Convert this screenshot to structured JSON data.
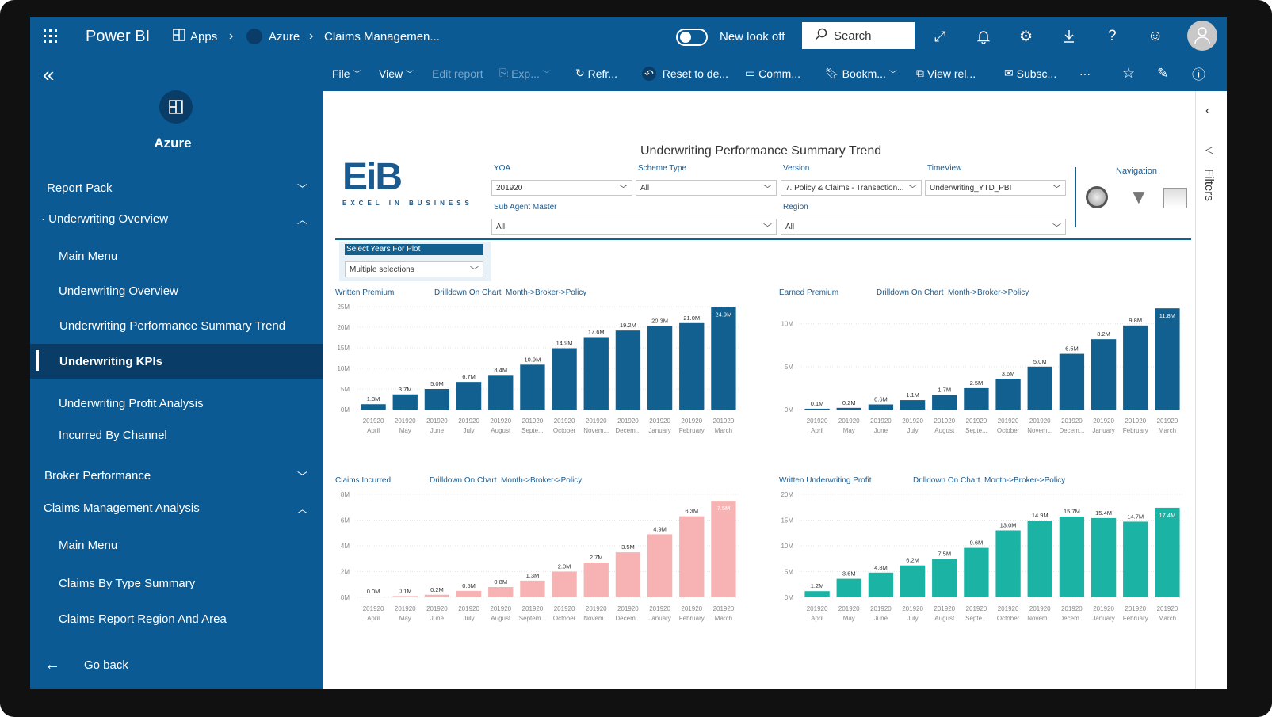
{
  "topbar": {
    "app_name": "Power BI",
    "breadcrumb": [
      {
        "label": "Apps"
      },
      {
        "label": "Azure"
      },
      {
        "label": "Claims Managemen..."
      }
    ],
    "new_look_label": "New look off",
    "search_placeholder": "Search"
  },
  "sidebar": {
    "workspace_name": "Azure",
    "items": [
      {
        "label": "Report Pack"
      },
      {
        "label": "Underwriting Overview"
      },
      {
        "label": "Main Menu"
      },
      {
        "label": "Underwriting Overview"
      },
      {
        "label": "Underwriting Performance Summary Trend"
      },
      {
        "label": "Underwriting KPIs"
      },
      {
        "label": "Underwriting Profit Analysis"
      },
      {
        "label": "Incurred By Channel"
      },
      {
        "label": "Broker Performance"
      },
      {
        "label": "Claims Management Analysis"
      },
      {
        "label": "Main Menu"
      },
      {
        "label": "Claims By Type Summary"
      },
      {
        "label": "Claims Report Region And Area"
      }
    ],
    "go_back": "Go back"
  },
  "actionbar": {
    "file": "File",
    "view": "View",
    "edit_report": "Edit report",
    "export": "Exp...",
    "refresh": "Refr...",
    "reset": "Reset to de...",
    "comments": "Comm...",
    "bookmarks": "Bookm...",
    "view_related": "View rel...",
    "subscribe": "Subsc...",
    "more": "···"
  },
  "rightpane": {
    "filters": "Filters"
  },
  "report": {
    "title": "Underwriting Performance Summary Trend",
    "logo_text": "EiB",
    "logo_sub": "EXCEL IN BUSINESS",
    "filters": {
      "yoa_label": "YOA",
      "yoa_value": "201920",
      "scheme_label": "Scheme Type",
      "scheme_value": "All",
      "version_label": "Version",
      "version_value": "7. Policy & Claims - Transaction...",
      "timeview_label": "TimeView",
      "timeview_value": "Underwriting_YTD_PBI",
      "subagent_label": "Sub Agent Master",
      "subagent_value": "All",
      "region_label": "Region",
      "region_value": "All",
      "navigation_label": "Navigation",
      "years_label": "Select Years For Plot",
      "years_value": "Multiple selections"
    },
    "drill_label": "Drilldown On Chart",
    "drill_path": "Month->Broker->Policy"
  },
  "chart_data": [
    {
      "type": "bar",
      "title": "Written Premium",
      "color": "#11608f",
      "year": "201920",
      "categories": [
        "April",
        "May",
        "June",
        "July",
        "August",
        "Septe...",
        "October",
        "Novem...",
        "Decem...",
        "January",
        "February",
        "March"
      ],
      "values": [
        1.3,
        3.7,
        5.0,
        6.7,
        8.4,
        10.9,
        14.9,
        17.6,
        19.2,
        20.3,
        21.0,
        24.9
      ],
      "labels": [
        "1.3M",
        "3.7M",
        "5.0M",
        "6.7M",
        "8.4M",
        "10.9M",
        "14.9M",
        "17.6M",
        "19.2M",
        "20.3M",
        "21.0M",
        "24.9M"
      ],
      "yticks": [
        "0M",
        "5M",
        "10M",
        "15M",
        "20M",
        "25M"
      ],
      "ylim": [
        0,
        25
      ]
    },
    {
      "type": "bar",
      "title": "Earned Premium",
      "color": "#11608f",
      "year": "201920",
      "categories": [
        "April",
        "May",
        "June",
        "July",
        "August",
        "Septe...",
        "October",
        "Novem...",
        "Decem...",
        "January",
        "February",
        "March"
      ],
      "values": [
        0.1,
        0.2,
        0.6,
        1.1,
        1.7,
        2.5,
        3.6,
        5.0,
        6.5,
        8.2,
        9.8,
        11.8
      ],
      "labels": [
        "0.1M",
        "0.2M",
        "0.6M",
        "1.1M",
        "1.7M",
        "2.5M",
        "3.6M",
        "5.0M",
        "6.5M",
        "8.2M",
        "9.8M",
        "11.8M"
      ],
      "yticks": [
        "0M",
        "5M",
        "10M"
      ],
      "ylim": [
        0,
        12
      ]
    },
    {
      "type": "bar",
      "title": "Claims Incurred",
      "color": "#f7b3b3",
      "year": "201920",
      "categories": [
        "April",
        "May",
        "June",
        "July",
        "August",
        "Septem...",
        "October",
        "Novem...",
        "Decem...",
        "January",
        "February",
        "March"
      ],
      "values": [
        0.0,
        0.1,
        0.2,
        0.5,
        0.8,
        1.3,
        2.0,
        2.7,
        3.5,
        4.9,
        6.3,
        7.5
      ],
      "labels": [
        "0.0M",
        "0.1M",
        "0.2M",
        "0.5M",
        "0.8M",
        "1.3M",
        "2.0M",
        "2.7M",
        "3.5M",
        "4.9M",
        "6.3M",
        "7.5M"
      ],
      "yticks": [
        "0M",
        "2M",
        "4M",
        "6M",
        "8M"
      ],
      "ylim": [
        0,
        8
      ]
    },
    {
      "type": "bar",
      "title": "Written Underwriting Profit",
      "color": "#1ab3a4",
      "year": "201920",
      "categories": [
        "April",
        "May",
        "June",
        "July",
        "August",
        "Septe...",
        "October",
        "Novem...",
        "Decem...",
        "January",
        "February",
        "March"
      ],
      "values": [
        1.2,
        3.6,
        4.8,
        6.2,
        7.5,
        9.6,
        13.0,
        14.9,
        15.7,
        15.4,
        14.7,
        17.4
      ],
      "labels": [
        "1.2M",
        "3.6M",
        "4.8M",
        "6.2M",
        "7.5M",
        "9.6M",
        "13.0M",
        "14.9M",
        "15.7M",
        "15.4M",
        "14.7M",
        "17.4M"
      ],
      "yticks": [
        "0M",
        "5M",
        "10M",
        "15M",
        "20M"
      ],
      "ylim": [
        0,
        20
      ]
    }
  ]
}
